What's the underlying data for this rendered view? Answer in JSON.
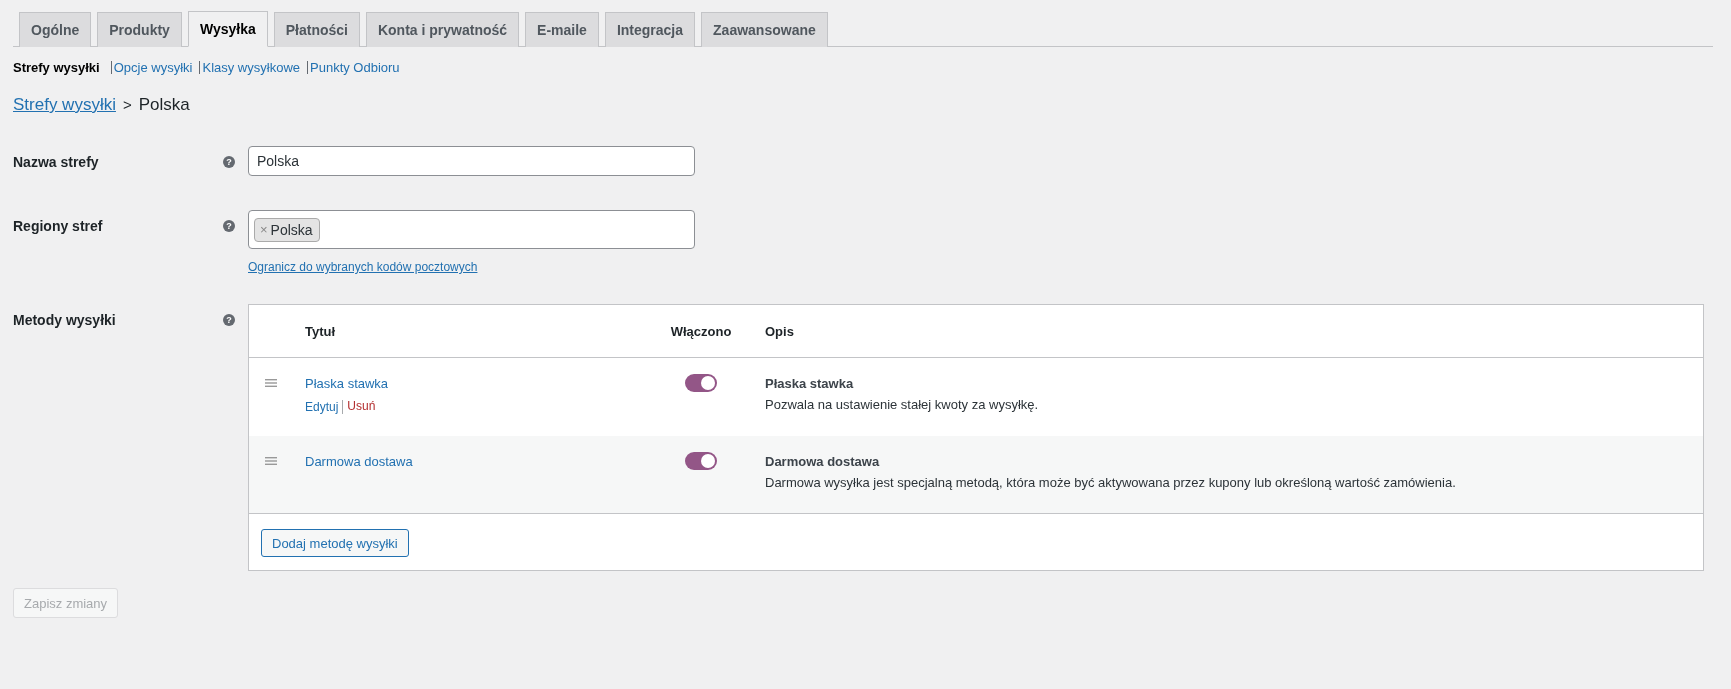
{
  "tabs": [
    {
      "label": "Ogólne",
      "selected": false
    },
    {
      "label": "Produkty",
      "selected": false
    },
    {
      "label": "Wysyłka",
      "selected": true
    },
    {
      "label": "Płatności",
      "selected": false
    },
    {
      "label": "Konta i prywatność",
      "selected": false
    },
    {
      "label": "E-maile",
      "selected": false
    },
    {
      "label": "Integracja",
      "selected": false
    },
    {
      "label": "Zaawansowane",
      "selected": false
    }
  ],
  "subnav": [
    {
      "label": "Strefy wysyłki",
      "selected": true
    },
    {
      "label": "Opcje wysyłki",
      "selected": false
    },
    {
      "label": "Klasy wysyłkowe",
      "selected": false
    },
    {
      "label": "Punkty Odbioru",
      "selected": false
    }
  ],
  "breadcrumb": {
    "link": "Strefy wysyłki",
    "separator": ">",
    "current": "Polska"
  },
  "zone_name": {
    "label": "Nazwa strefy",
    "help": "?",
    "value": "Polska"
  },
  "zone_regions": {
    "label": "Regiony stref",
    "help": "?",
    "tags": [
      {
        "remove": "×",
        "label": "Polska"
      }
    ],
    "link": "Ogranicz do wybranych kodów pocztowych"
  },
  "methods": {
    "label": "Metody wysyłki",
    "help": "?",
    "columns": [
      "Tytuł",
      "Włączono",
      "Opis"
    ],
    "rows": [
      {
        "title": "Płaska stawka",
        "enabled": true,
        "actions": [
          {
            "label": "Edytuj",
            "kind": "edit"
          },
          {
            "label": "Usuń",
            "kind": "delete"
          }
        ],
        "desc_title": "Płaska stawka",
        "description": "Pozwala na ustawienie stałej kwoty za wysyłkę."
      },
      {
        "title": "Darmowa dostawa",
        "enabled": true,
        "desc_title": "Darmowa dostawa",
        "description": "Darmowa wysyłka jest specjalną metodą, która może być aktywowana przez kupony lub określoną wartość zamówienia."
      }
    ],
    "add_button": "Dodaj metodę wysyłki"
  },
  "save_button": {
    "label": "Zapisz zmiany",
    "disabled": true
  }
}
